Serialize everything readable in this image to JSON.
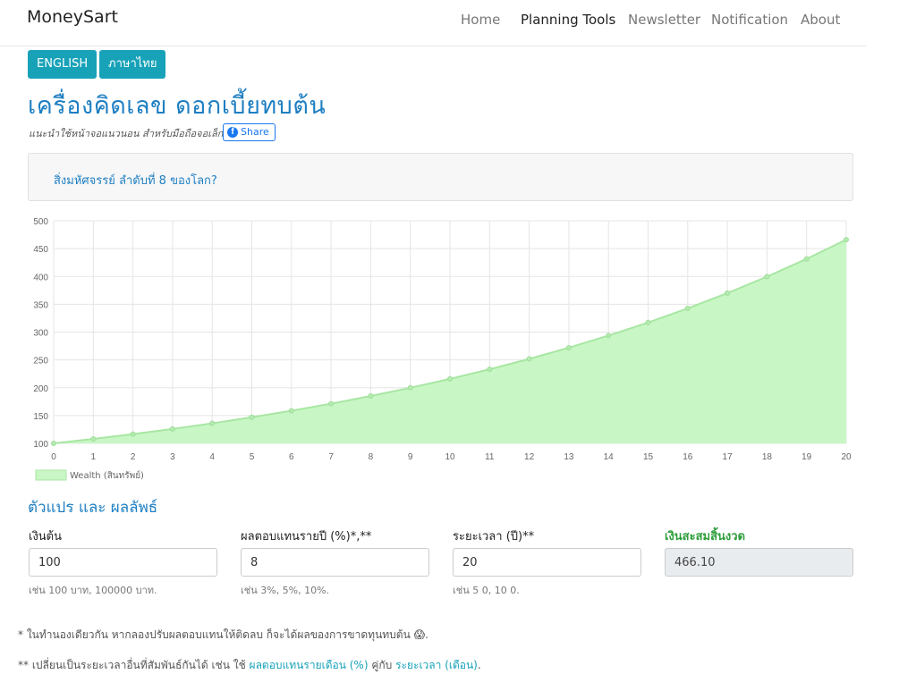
{
  "nav": {
    "brand": "MoneySart",
    "links": [
      "Home",
      "Planning Tools",
      "Newsletter",
      "Notification",
      "About"
    ],
    "active": "Planning Tools"
  },
  "lang": {
    "english": "ENGLISH",
    "thai": "ภาษาไทย"
  },
  "page": {
    "title": "เครื่องคิดเลข ดอกเบี้ยทบต้น",
    "hint": "แนะนำใช้หน้าจอแนวนอน สำหรับมือถือจอเล็ก",
    "share": "Share",
    "banner": "สิ่งมหัศจรรย์ ลำดับที่ 8 ของโลก?"
  },
  "chart_data": {
    "type": "area",
    "x": [
      0,
      1,
      2,
      3,
      4,
      5,
      6,
      7,
      8,
      9,
      10,
      11,
      12,
      13,
      14,
      15,
      16,
      17,
      18,
      19,
      20
    ],
    "series": [
      {
        "name": "Wealth (สินทรัพย์)",
        "values": [
          100,
          108,
          116.64,
          125.97,
          136.05,
          146.93,
          158.69,
          171.38,
          185.09,
          199.9,
          215.89,
          233.16,
          251.82,
          271.96,
          293.72,
          317.22,
          342.59,
          370,
          399.6,
          431.57,
          466.1
        ],
        "color": "#90ee90"
      }
    ],
    "yticks": [
      100,
      150,
      200,
      250,
      300,
      350,
      400,
      450,
      500
    ],
    "ylim": [
      100,
      500
    ],
    "xlim": [
      0,
      20
    ],
    "grid": true,
    "legend": "bottom-left"
  },
  "vars": {
    "title": "ตัวแปร และ ผลลัพธ์",
    "principal": {
      "label": "เงินต้น",
      "value": "100",
      "help": "เช่น 100 บาท, 100000 บาท."
    },
    "rate": {
      "label": "ผลตอบแทนรายปี (%)*,**",
      "value": "8",
      "help": "เช่น 3%, 5%, 10%."
    },
    "period": {
      "label": "ระยะเวลา (ปี)**",
      "value": "20",
      "help": "เช่น 5 0, 10 0."
    },
    "result": {
      "label": "เงินสะสมสิ้นงวด",
      "value": "466.10"
    }
  },
  "notes": {
    "note1": "* ในทำนองเดียวกัน หากลองปรับผลตอบแทนให้ติดลบ ก็จะได้ผลของการขาดทุนทบต้น 😱.",
    "note2_prefix": "** เปลี่ยนเป็นระยะเวลาอื่นที่สัมพันธ์กันได้ เช่น ใช้",
    "note2_link1": "ผลตอบแทนรายเดือน (%)",
    "note2_mid": "คู่กับ",
    "note2_link2": "ระยะเวลา (เดือน)",
    "note2_suffix": "."
  }
}
